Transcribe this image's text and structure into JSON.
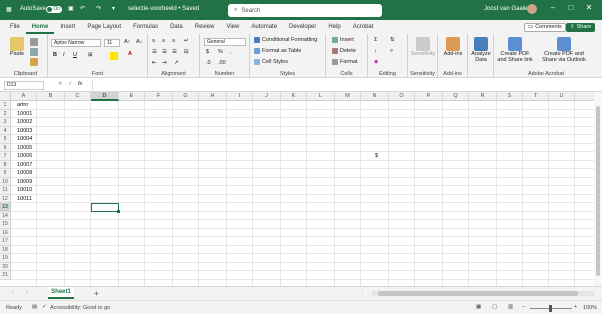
{
  "titlebar": {
    "autosave_label": "AutoSave",
    "autosave_state": "On",
    "doc_title": "selectie-voorbeeld • Saved",
    "search_placeholder": "Search",
    "user_name": "Joost van Gaalen"
  },
  "menubar": {
    "tabs": [
      "File",
      "Home",
      "Insert",
      "Page Layout",
      "Formulas",
      "Data",
      "Review",
      "View",
      "Automate",
      "Developer",
      "Help",
      "Acrobat"
    ],
    "active_tab": "Home",
    "comments_label": "Comments",
    "share_label": "Share"
  },
  "ribbon": {
    "clipboard": {
      "paste_label": "Paste",
      "group_label": "Clipboard"
    },
    "font": {
      "font_name": "Aptos Narrow",
      "font_size": "11",
      "group_label": "Font"
    },
    "alignment": {
      "group_label": "Alignment"
    },
    "number": {
      "format": "General",
      "group_label": "Number"
    },
    "styles": {
      "conditional_label": "Conditional Formatting",
      "format_table_label": "Format as Table",
      "cell_styles_label": "Cell Styles",
      "group_label": "Styles"
    },
    "cells": {
      "insert_label": "Insert",
      "delete_label": "Delete",
      "format_label": "Format",
      "group_label": "Cells"
    },
    "editing": {
      "group_label": "Editing"
    },
    "sensitivity": {
      "label": "Sensitivity",
      "group_label": "Sensitivity"
    },
    "addins": {
      "label": "Add-ins",
      "group_label": "Add-ins"
    },
    "analyze": {
      "label1": "Analyze",
      "label2": "Data"
    },
    "acrobat": {
      "pdf1_l1": "Create PDF",
      "pdf1_l2": "and Share link",
      "pdf2_l1": "Create PDF and",
      "pdf2_l2": "Share via Outlook",
      "group_label": "Adobe Acrobat"
    }
  },
  "formula_bar": {
    "name_box": "D13",
    "fx_label": "fx",
    "content": ""
  },
  "columns": [
    "A",
    "B",
    "C",
    "D",
    "E",
    "F",
    "G",
    "H",
    "I",
    "J",
    "K",
    "L",
    "M",
    "N",
    "O",
    "P",
    "Q",
    "R",
    "S",
    "T",
    "U"
  ],
  "active_column": "D",
  "rows": [
    "1",
    "2",
    "3",
    "4",
    "5",
    "6",
    "7",
    "8",
    "9",
    "10",
    "11",
    "12",
    "13",
    "14",
    "15",
    "16",
    "17",
    "18",
    "19",
    "20",
    "21"
  ],
  "active_row": "13",
  "cells_a": [
    "artnr",
    "10001",
    "10002",
    "10003",
    "10004",
    "10005",
    "10006",
    "10007",
    "10008",
    "10009",
    "10010",
    "10011"
  ],
  "cell_n7": "$",
  "sheet": {
    "tab_name": "Sheet1",
    "add_label": "+"
  },
  "statusbar": {
    "ready": "Ready",
    "accessibility": "Accessibility: Good to go",
    "zoom": "100%"
  },
  "colors": {
    "brand": "#217346",
    "selection": "#217346"
  }
}
